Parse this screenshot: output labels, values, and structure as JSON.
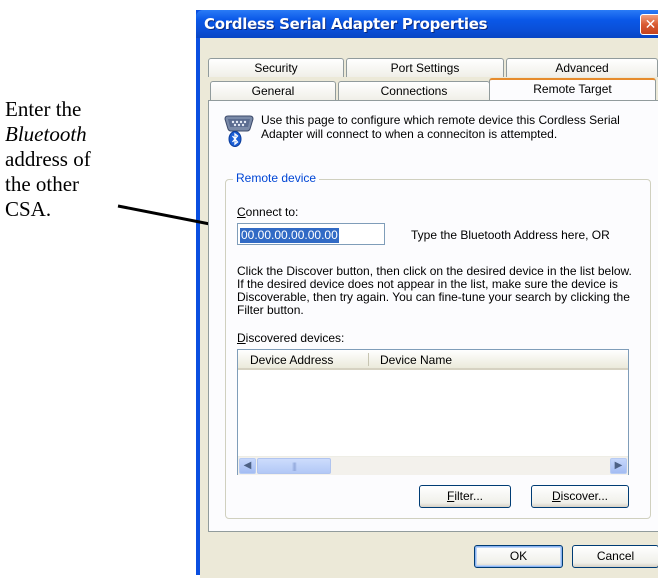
{
  "annotation": {
    "line1": "Enter the",
    "line2": "Bluetooth",
    "line3": "address of",
    "line4": "the other",
    "line5": "CSA."
  },
  "window": {
    "title": "Cordless Serial Adapter Properties",
    "close_glyph": "✕"
  },
  "tabs": {
    "row1": [
      "Security",
      "Port Settings",
      "Advanced"
    ],
    "row2": [
      "General",
      "Connections",
      "Remote Target"
    ],
    "active": "Remote Target"
  },
  "page": {
    "icon": "serial-port-bluetooth-icon",
    "description": "Use this page to configure which remote device this Cordless Serial Adapter will connect to when a conneciton is attempted.",
    "group_title": "Remote device",
    "connect_label_first": "C",
    "connect_label_rest": "onnect to:",
    "address_value": "00.00.00.00.00.00",
    "address_hint": "Type the Bluetooth Address here, OR",
    "instructions": "Click the Discover button, then click on the desired device in the list below. If the desired device does not appear in the list, make sure the device is Discoverable, then try again. You can fine-tune your search by clicking the Filter button.",
    "discovered_label_first": "D",
    "discovered_label_rest": "iscovered devices:",
    "columns": [
      "Device Address",
      "Device Name"
    ],
    "filter_first": "F",
    "filter_rest": "ilter...",
    "discover_first": "D",
    "discover_pre": "",
    "discover_rest": "iscover..."
  },
  "footer": {
    "ok": "OK",
    "cancel": "Cancel"
  },
  "colors": {
    "titlebar": "#0a58e8",
    "accent_tab": "#e68b2c",
    "group_title": "#0046d5",
    "selection": "#316ac5"
  }
}
